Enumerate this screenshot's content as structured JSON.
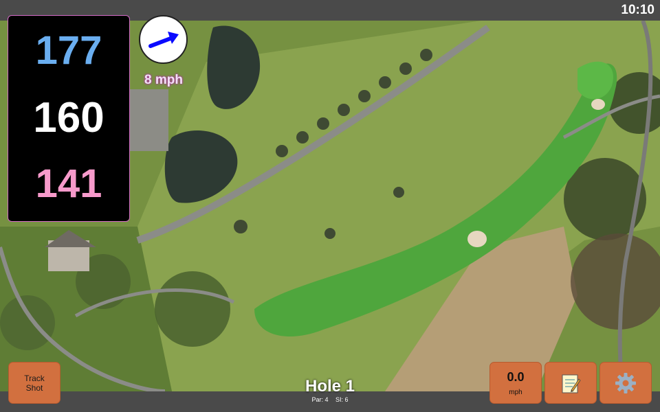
{
  "status": {
    "clock": "10:10"
  },
  "distances": {
    "back": "177",
    "center": "160",
    "front": "141"
  },
  "wind": {
    "speed": "8 mph",
    "icon": "wind-arrow-icon"
  },
  "hole": {
    "title": "Hole 1",
    "par": "Par: 4",
    "stroke_index": "SI: 6"
  },
  "buttons": {
    "track_shot_line1": "Track",
    "track_shot_line2": "Shot",
    "speed_value": "0.0",
    "speed_unit": "mph",
    "notes_icon": "notepad-icon",
    "settings_icon": "gear-icon"
  },
  "colors": {
    "back": "#6aaef0",
    "center": "#ffffff",
    "front": "#f79acb",
    "button": "#d2703f",
    "panel_border": "#d46bc7"
  }
}
